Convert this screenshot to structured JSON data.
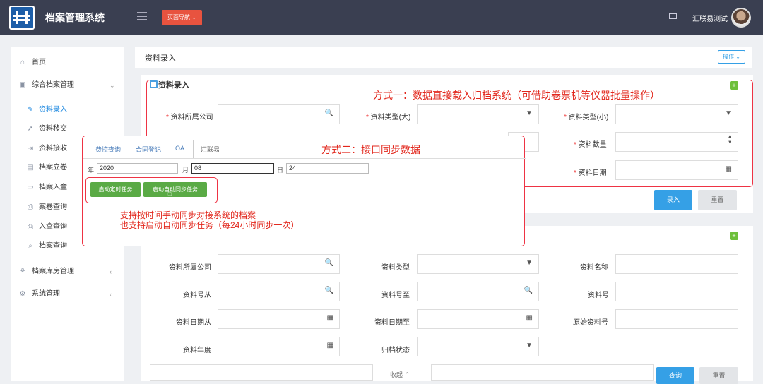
{
  "header": {
    "app_title": "档案管理系统",
    "nav_button": "页面导航",
    "nav_caret": "⌄",
    "user_name": "汇联易测试"
  },
  "sidebar": {
    "items": [
      {
        "label": "首页",
        "icon": "⌂"
      },
      {
        "label": "综合档案管理",
        "icon": "▣",
        "arrow": "⌄"
      },
      {
        "label": "资料录入",
        "icon": "✎"
      },
      {
        "label": "资料移交",
        "icon": "➚"
      },
      {
        "label": "资料接收",
        "icon": "⇥"
      },
      {
        "label": "档案立卷",
        "icon": "▤"
      },
      {
        "label": "档案入盒",
        "icon": "▭"
      },
      {
        "label": "案卷查询",
        "icon": "⎙"
      },
      {
        "label": "入盒查询",
        "icon": "⎙"
      },
      {
        "label": "档案查询",
        "icon": "⌕"
      },
      {
        "label": "档案库房管理",
        "icon": "⚘",
        "arrow": "‹"
      },
      {
        "label": "系统管理",
        "icon": "⚙",
        "arrow": "‹"
      }
    ]
  },
  "breadcrumb": {
    "title": "资料录入",
    "ops_button": "操作 ⌄"
  },
  "entry_panel": {
    "title": "资料录入",
    "plus": "+",
    "company_label": "资料所属公司",
    "type_big_label": "资料类型(大)",
    "type_small_label": "资料类型(小)",
    "qty_label": "资料数量",
    "date_label": "资料日期",
    "submit": "录入",
    "reset": "重置"
  },
  "query_panel": {
    "plus": "+",
    "company": "资料所属公司",
    "type": "资料类型",
    "name": "资料名称",
    "no_from": "资料号从",
    "no_to": "资料号至",
    "no": "资料号",
    "date_from": "资料日期从",
    "date_to": "资料日期至",
    "orig_no": "原始资料号",
    "year": "资料年度",
    "archive_status": "归档状态",
    "collapse": "收起 ⌃",
    "search": "查询",
    "reset": "重置"
  },
  "annotations": {
    "method1": "方式一：数据直接载入归档系统（可借助卷票机等仪器批量操作）",
    "method2": "方式二：接口同步数据",
    "note_line1": "支持按时间手动同步对接系统的档案",
    "note_line2": "也支持启动自动同步任务（每24小时同步一次）"
  },
  "popup": {
    "tabs": [
      "费控查询",
      "合同登记",
      "OA",
      "汇联易"
    ],
    "year_label": "年:",
    "year_value": "2020",
    "month_label": "月:",
    "month_value": "08",
    "day_label": "日:",
    "day_value": "24",
    "btn_timed": "启动定时任务",
    "btn_auto": "启动自动同步任务"
  },
  "icons": {
    "search": "🔍",
    "select": "▼",
    "calendar": "▦",
    "spin_up": "▲",
    "spin_down": "▼"
  },
  "colors": {
    "header_bg": "#3a3f51",
    "nav_btn": "#e8533f",
    "accent": "#35a0e6",
    "annot_red": "#e2271c",
    "green": "#5aaa45"
  }
}
